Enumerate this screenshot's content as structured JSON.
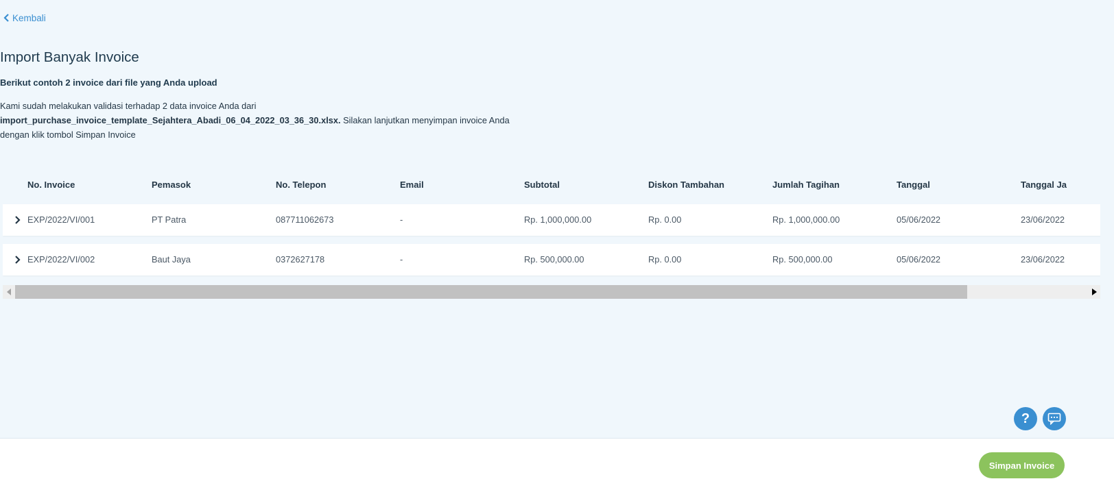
{
  "nav": {
    "back_label": "Kembali"
  },
  "page": {
    "title": "Import Banyak Invoice",
    "subtitle": "Berikut contoh 2 invoice dari file yang Anda upload",
    "desc_part1": "Kami sudah melakukan validasi terhadap 2 data invoice Anda dari",
    "desc_filename": "import_purchase_invoice_template_Sejahtera_Abadi_06_04_2022_03_36_30.xlsx.",
    "desc_part2": " Silakan lanjutkan menyimpan invoice Anda dengan klik tombol Simpan Invoice"
  },
  "table": {
    "columns": [
      "No. Invoice",
      "Pemasok",
      "No. Telepon",
      "Email",
      "Subtotal",
      "Diskon Tambahan",
      "Jumlah Tagihan",
      "Tanggal",
      "Tanggal Ja"
    ],
    "rows": [
      [
        "EXP/2022/VI/001",
        "PT Patra",
        "087711062673",
        "-",
        "Rp. 1,000,000.00",
        "Rp. 0.00",
        "Rp. 1,000,000.00",
        "05/06/2022",
        "23/06/2022"
      ],
      [
        "EXP/2022/VI/002",
        "Baut Jaya",
        "0372627178",
        "-",
        "Rp. 500,000.00",
        "Rp. 0.00",
        "Rp. 500,000.00",
        "05/06/2022",
        "23/06/2022"
      ]
    ]
  },
  "icons": {
    "back": "chevron-left-icon",
    "expand": "chevron-right-icon",
    "help": "help-icon",
    "chat": "chat-icon"
  },
  "help": {
    "glyph": "?"
  },
  "footer": {
    "save_label": "Simpan Invoice"
  },
  "colors": {
    "accent": "#3a8fd1",
    "primary_button": "#8cc35d",
    "background": "#f0f7fc"
  }
}
